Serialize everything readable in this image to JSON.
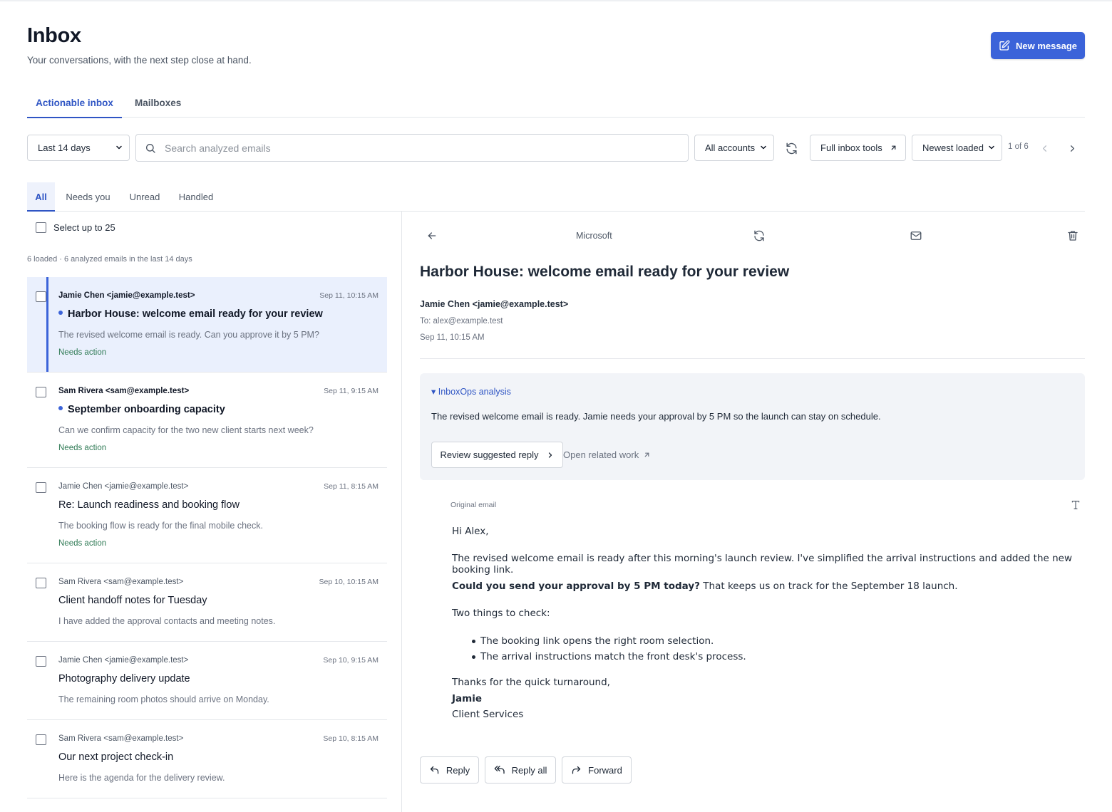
{
  "header": {
    "title": "Inbox",
    "subtitle": "Your conversations, with the next step close at hand.",
    "new_message_label": "New message"
  },
  "main_tabs": [
    {
      "label": "Actionable inbox",
      "active": true
    },
    {
      "label": "Mailboxes",
      "active": false
    }
  ],
  "toolbar": {
    "date_range": "Last 14 days",
    "search_placeholder": "Search analyzed emails",
    "accounts": "All accounts",
    "full_inbox_tools": "Full inbox tools",
    "sort": "Newest loaded",
    "pager": "1 of 6"
  },
  "filter_tabs": [
    {
      "label": "All",
      "active": true
    },
    {
      "label": "Needs you",
      "active": false
    },
    {
      "label": "Unread",
      "active": false
    },
    {
      "label": "Handled",
      "active": false
    }
  ],
  "list": {
    "select_label": "Select up to 25",
    "meta": "6 loaded · 6 analyzed emails in the last 14 days",
    "items": [
      {
        "from": "Jamie Chen <jamie@example.test>",
        "date": "Sep 11, 10:15 AM",
        "subject": "Harbor House: welcome email ready for your review",
        "preview": "The revised welcome email is ready. Can you approve it by 5 PM?",
        "badge": "Needs action",
        "unread": true,
        "selected": true
      },
      {
        "from": "Sam Rivera <sam@example.test>",
        "date": "Sep 11, 9:15 AM",
        "subject": "September onboarding capacity",
        "preview": "Can we confirm capacity for the two new client starts next week?",
        "badge": "Needs action",
        "unread": true,
        "selected": false
      },
      {
        "from": "Jamie Chen <jamie@example.test>",
        "date": "Sep 11, 8:15 AM",
        "subject": "Re: Launch readiness and booking flow",
        "preview": "The booking flow is ready for the final mobile check.",
        "badge": "Needs action",
        "unread": false,
        "selected": false
      },
      {
        "from": "Sam Rivera <sam@example.test>",
        "date": "Sep 10, 10:15 AM",
        "subject": "Client handoff notes for Tuesday",
        "preview": "I have added the approval contacts and meeting notes.",
        "badge": "",
        "unread": false,
        "selected": false
      },
      {
        "from": "Jamie Chen <jamie@example.test>",
        "date": "Sep 10, 9:15 AM",
        "subject": "Photography delivery update",
        "preview": "The remaining room photos should arrive on Monday.",
        "badge": "",
        "unread": false,
        "selected": false
      },
      {
        "from": "Sam Rivera <sam@example.test>",
        "date": "Sep 10, 8:15 AM",
        "subject": "Our next project check-in",
        "preview": "Here is the agenda for the delivery review.",
        "badge": "",
        "unread": false,
        "selected": false
      }
    ]
  },
  "detail": {
    "source": "Microsoft",
    "subject": "Harbor House: welcome email ready for your review",
    "from": "Jamie Chen <jamie@example.test>",
    "to": "To: alex@example.test",
    "date": "Sep 11, 10:15 AM",
    "analysis": {
      "title": "▾ InboxOps analysis",
      "text": "The revised welcome email is ready. Jamie needs your approval by 5 PM so the launch can stay on schedule.",
      "review_label": "Review suggested reply",
      "related_label": "Open related work"
    },
    "original_label": "Original email",
    "body": {
      "greeting": "Hi Alex,",
      "para1": "The revised welcome email is ready after this morning's launch review. I've simplified the arrival instructions and added the new booking link.",
      "para2_bold": "Could you send your approval by 5 PM today?",
      "para2_rest": " That keeps us on track for the September 18 launch.",
      "para3": "Two things to check:",
      "bullets": [
        "The booking link opens the right room selection.",
        "The arrival instructions match the front desk's process."
      ],
      "closing": "Thanks for the quick turnaround,",
      "signature_name": "Jamie",
      "signature_title": "Client Services"
    },
    "actions": {
      "reply": "Reply",
      "reply_all": "Reply all",
      "forward": "Forward"
    }
  },
  "icons": [
    "edit-icon",
    "search-icon",
    "refresh-icon",
    "external-link-icon",
    "chevron-left-icon",
    "chevron-right-icon",
    "back-arrow-icon",
    "mail-icon",
    "trash-icon",
    "text-format-icon",
    "reply-icon",
    "reply-all-icon",
    "forward-icon"
  ],
  "colors": {
    "accent": "#3b63d9",
    "needs_action": "#2f7a55",
    "selected_bg": "#eaf0fd",
    "analysis_bg": "#f2f4f8"
  }
}
